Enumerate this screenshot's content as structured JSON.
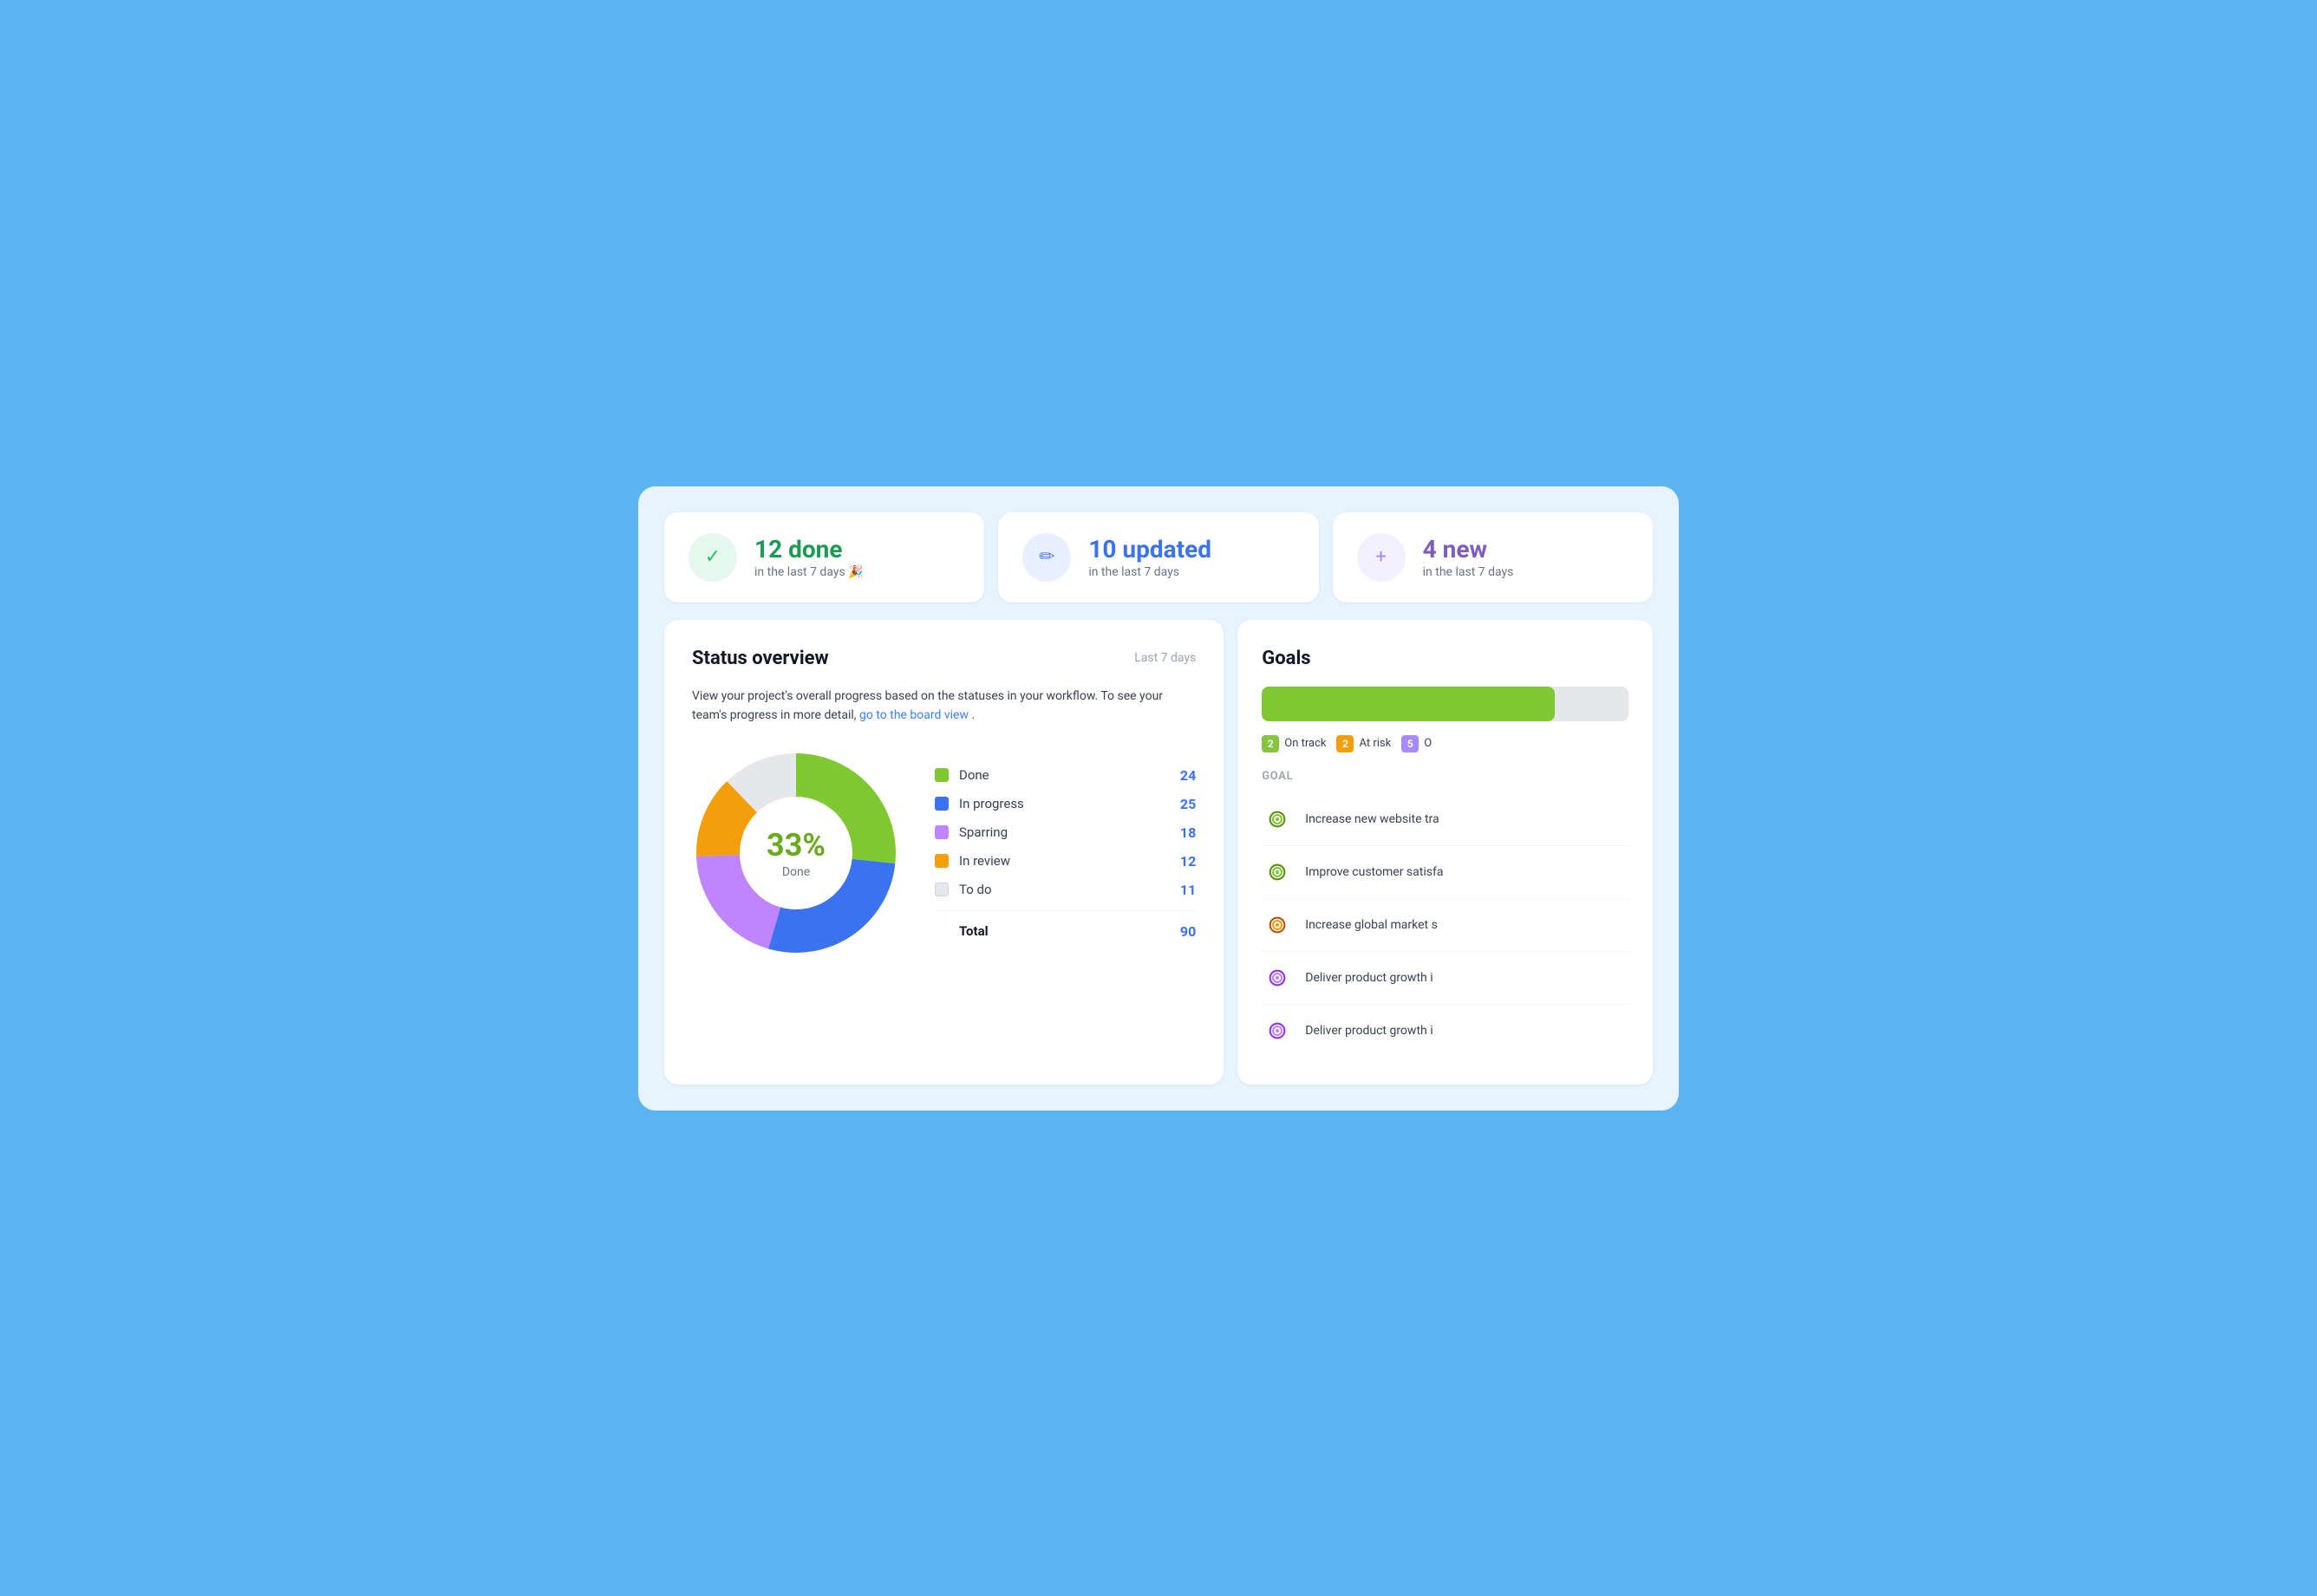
{
  "stats": [
    {
      "id": "done",
      "number": "12 done",
      "label": "in the last 7 days 🎉",
      "icon": "✓",
      "icon_class": "green",
      "number_class": "green"
    },
    {
      "id": "updated",
      "number": "10 updated",
      "label": "in the last 7 days",
      "icon": "✏",
      "icon_class": "blue",
      "number_class": "blue"
    },
    {
      "id": "new",
      "number": "4 new",
      "label": "in the last 7 days",
      "icon": "+",
      "icon_class": "purple",
      "number_class": "purple"
    }
  ],
  "status_overview": {
    "title": "Status overview",
    "period": "Last 7 days",
    "description_part1": "View your project's overall progress based on the statuses in your workflow. To see your team's progress in more detail,",
    "description_link": "go to the board view",
    "description_part2": ".",
    "donut": {
      "percent": "33%",
      "label": "Done",
      "segments": [
        {
          "name": "Done",
          "value": 24,
          "color": "#7fc832",
          "percentage": 26.7
        },
        {
          "name": "In progress",
          "value": 25,
          "color": "#3b72f0",
          "percentage": 27.8
        },
        {
          "name": "Sparring",
          "value": 18,
          "color": "#c084fc",
          "percentage": 20.0
        },
        {
          "name": "In review",
          "value": 12,
          "color": "#f59e0b",
          "percentage": 13.3
        },
        {
          "name": "To do",
          "value": 11,
          "color": "#e5e7eb",
          "percentage": 12.2
        }
      ],
      "total": 90
    }
  },
  "goals": {
    "title": "Goals",
    "progress_color": "#7fc832",
    "progress_width": "80%",
    "filters": [
      {
        "label": "On track",
        "count": "2",
        "badge_class": "green"
      },
      {
        "label": "At risk",
        "count": "2",
        "badge_class": "yellow"
      },
      {
        "label": "Off track",
        "count": "5",
        "badge_class": "purple"
      }
    ],
    "column_header": "Goal",
    "items": [
      {
        "name": "Increase new website tra",
        "icon_type": "target",
        "icon_color": "#7fc832",
        "icon_ring": "#5a9010"
      },
      {
        "name": "Improve customer satisfa",
        "icon_type": "target",
        "icon_color": "#7fc832",
        "icon_ring": "#5a9010"
      },
      {
        "name": "Increase global market s",
        "icon_type": "target",
        "icon_color": "#f59e0b",
        "icon_ring": "#b45309"
      },
      {
        "name": "Deliver product growth i",
        "icon_type": "target",
        "icon_color": "#c084fc",
        "icon_ring": "#9333ea"
      },
      {
        "name": "Deliver product growth i",
        "icon_type": "target",
        "icon_color": "#c084fc",
        "icon_ring": "#9333ea"
      }
    ]
  }
}
